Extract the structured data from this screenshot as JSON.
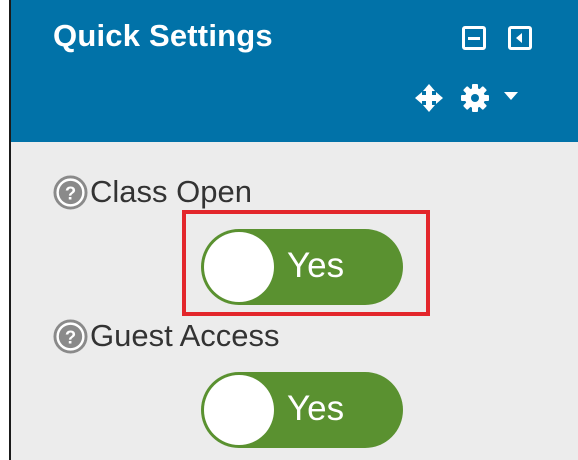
{
  "block": {
    "title": "Quick Settings",
    "controls": {
      "minimize_icon": "minimize-icon",
      "dock_icon": "dock-icon",
      "move_icon": "move-icon",
      "gear_icon": "gear-icon",
      "caret_icon": "caret-down-icon"
    }
  },
  "settings": [
    {
      "label": "Class Open",
      "toggle_value": "Yes",
      "enabled": true
    },
    {
      "label": "Guest Access",
      "toggle_value": "Yes",
      "enabled": true
    }
  ],
  "colors": {
    "header_bg": "#0172a8",
    "body_bg": "#ececec",
    "toggle_on": "#5a9130",
    "highlight": "#e3262b",
    "help_icon": "#8a8a8a"
  }
}
